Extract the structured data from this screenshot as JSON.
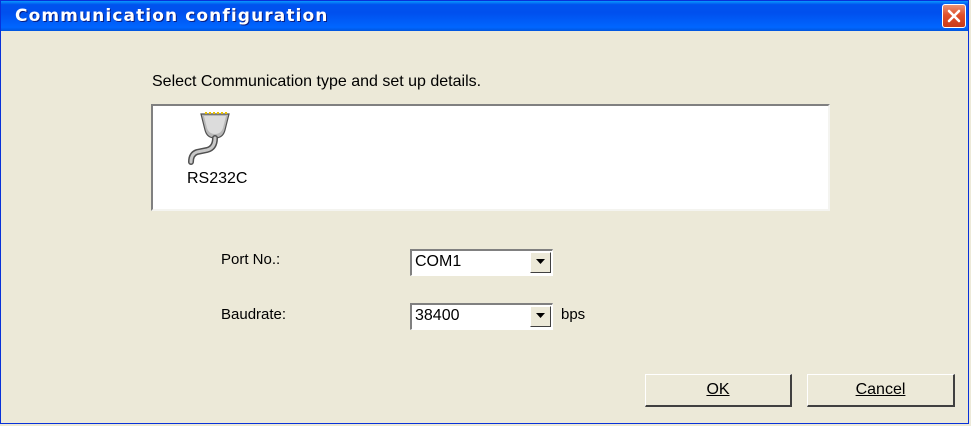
{
  "window": {
    "title": "Communication configuration",
    "close_icon": "close-icon"
  },
  "instruction": "Select Communication type and set up details.",
  "communication_types": [
    {
      "label": "RS232C",
      "icon": "serial-port-icon",
      "selected": true
    }
  ],
  "port": {
    "label": "Port No.:",
    "value": "COM1"
  },
  "baudrate": {
    "label": "Baudrate:",
    "value": "38400",
    "unit": "bps"
  },
  "buttons": {
    "ok": "OK",
    "cancel": "Cancel"
  },
  "colors": {
    "titlebar": "#0054e3",
    "dialog_bg": "#ece9d8",
    "close_button": "#e0502b"
  }
}
